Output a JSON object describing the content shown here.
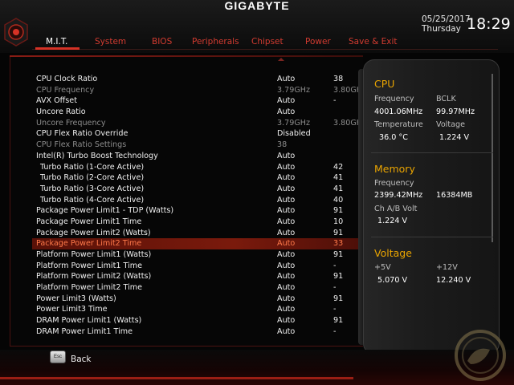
{
  "brand": "GIGABYTE",
  "datetime": {
    "date": "05/25/2017",
    "day": "Thursday",
    "time": "18:29"
  },
  "tabs": [
    {
      "label": "M.I.T.",
      "active": true
    },
    {
      "label": "System"
    },
    {
      "label": "BIOS"
    },
    {
      "label": "Peripherals"
    },
    {
      "label": "Chipset"
    },
    {
      "label": "Power"
    },
    {
      "label": "Save & Exit"
    }
  ],
  "settings": [
    {
      "label": "CPU Clock Ratio",
      "value": "Auto",
      "current": "38"
    },
    {
      "label": "CPU Frequency",
      "value": "3.79GHz",
      "current": "3.80GHz",
      "dim": true
    },
    {
      "label": "AVX Offset",
      "value": "Auto",
      "current": "-"
    },
    {
      "label": "Uncore Ratio",
      "value": "Auto",
      "current": ""
    },
    {
      "label": "Uncore Frequency",
      "value": "3.79GHz",
      "current": "3.80GHz",
      "dim": true
    },
    {
      "label": "CPU Flex Ratio Override",
      "value": "Disabled",
      "current": ""
    },
    {
      "label": "CPU Flex Ratio Settings",
      "value": "38",
      "current": "",
      "dim": true
    },
    {
      "label": "Intel(R) Turbo Boost Technology",
      "value": "Auto",
      "current": ""
    },
    {
      "label": "Turbo Ratio (1-Core Active)",
      "value": "Auto",
      "current": "42",
      "sub": true
    },
    {
      "label": "Turbo Ratio (2-Core Active)",
      "value": "Auto",
      "current": "41",
      "sub": true
    },
    {
      "label": "Turbo Ratio (3-Core Active)",
      "value": "Auto",
      "current": "41",
      "sub": true
    },
    {
      "label": "Turbo Ratio (4-Core Active)",
      "value": "Auto",
      "current": "40",
      "sub": true
    },
    {
      "label": "Package Power Limit1 - TDP (Watts)",
      "value": "Auto",
      "current": "91"
    },
    {
      "label": "Package Power Limit1 Time",
      "value": "Auto",
      "current": "10"
    },
    {
      "label": "Package Power Limit2 (Watts)",
      "value": "Auto",
      "current": "91"
    },
    {
      "label": "Package Power Limit2 Time",
      "value": "Auto",
      "current": "33",
      "selected": true
    },
    {
      "label": "Platform Power Limit1 (Watts)",
      "value": "Auto",
      "current": "91"
    },
    {
      "label": "Platform Power Limit1 Time",
      "value": "Auto",
      "current": "-"
    },
    {
      "label": "Platform Power Limit2 (Watts)",
      "value": "Auto",
      "current": "91"
    },
    {
      "label": "Platform Power Limit2 Time",
      "value": "Auto",
      "current": "-"
    },
    {
      "label": "Power Limit3 (Watts)",
      "value": "Auto",
      "current": "91"
    },
    {
      "label": "Power Limit3 Time",
      "value": "Auto",
      "current": "-"
    },
    {
      "label": "DRAM Power Limit1 (Watts)",
      "value": "Auto",
      "current": "91"
    },
    {
      "label": "DRAM Power Limit1 Time",
      "value": "Auto",
      "current": "-"
    }
  ],
  "panel": {
    "cpu": {
      "title": "CPU",
      "frequency_label": "Frequency",
      "frequency": "4001.06MHz",
      "bclk_label": "BCLK",
      "bclk": "99.97MHz",
      "temperature_label": "Temperature",
      "temperature": "36.0 °C",
      "voltage_label": "Voltage",
      "voltage": "1.224 V"
    },
    "memory": {
      "title": "Memory",
      "frequency_label": "Frequency",
      "frequency": "2399.42MHz",
      "size": "16384MB",
      "chab_label": "Ch A/B Volt",
      "chab": "1.224 V"
    },
    "voltage": {
      "title": "Voltage",
      "p5_label": "+5V",
      "p5": "5.070 V",
      "p12_label": "+12V",
      "p12": "12.240 V"
    }
  },
  "footer": {
    "esc_key": "Esc",
    "back_label": "Back"
  },
  "colors": {
    "accent": "#d63226",
    "section_title": "#e9a400",
    "selected_text": "#ff7a4a"
  }
}
